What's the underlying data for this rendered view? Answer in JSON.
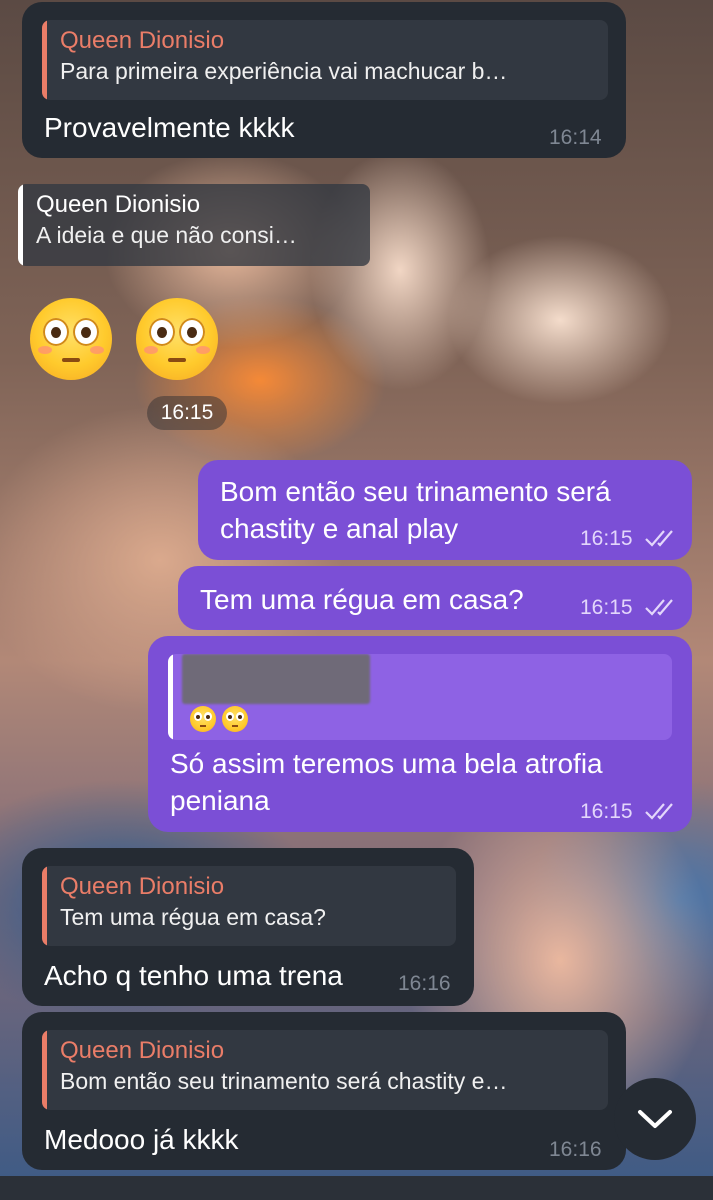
{
  "messages": [
    {
      "reply_name": "Queen Dionisio",
      "reply_text": "Para primeira experiência vai machucar b…",
      "text": "Provavelmente kkkk",
      "time": "16:14"
    },
    {
      "reply_name": "Queen Dionisio",
      "reply_text": "A ideia e que não consi…",
      "time": "16:15"
    },
    {
      "text_line1": "Bom então seu trinamento será",
      "text_line2": "chastity e anal play",
      "time": "16:15"
    },
    {
      "text": "Tem uma régua em casa?",
      "time": "16:15"
    },
    {
      "text_line1": "Só assim teremos uma bela atrofia",
      "text_line2": "peniana",
      "time": "16:15"
    },
    {
      "reply_name": "Queen Dionisio",
      "reply_text": "Tem uma régua em casa?",
      "text": "Acho q tenho uma trena",
      "time": "16:16"
    },
    {
      "reply_name": "Queen Dionisio",
      "reply_text": "Bom então seu trinamento será chastity e…",
      "text": "Medooo já kkkk",
      "time": "16:16"
    }
  ],
  "icons": {
    "emoji": "flushed-face",
    "read_receipt": "double-check",
    "scroll": "chevron-down"
  },
  "colors": {
    "incoming_bubble": "#252b33",
    "outgoing_bubble": "#7b4fd6",
    "reply_name": "#ea7d68"
  }
}
